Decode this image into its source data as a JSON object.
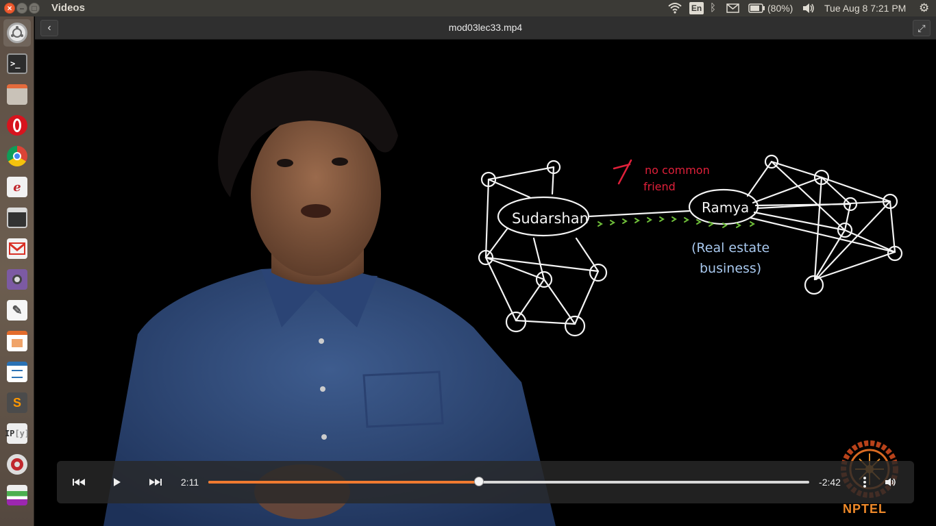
{
  "topbar": {
    "app_title": "Videos",
    "keyboard_layout": "En",
    "battery_percent": "(80%)",
    "datetime": "Tue Aug  8  7:21 PM"
  },
  "launcher": {
    "items": [
      "ubuntu-dash",
      "terminal",
      "files",
      "opera",
      "chrome",
      "evince",
      "videos",
      "gmail",
      "webcam",
      "text-editor",
      "impress",
      "writer",
      "sublime",
      "ipython",
      "settings",
      "misc"
    ]
  },
  "header": {
    "file_title": "mod03lec33.mp4",
    "back_icon": "‹",
    "fullscreen_icon": "⤢"
  },
  "whiteboard": {
    "node_left": "Sudarshan",
    "node_right": "Ramya",
    "annotation_red_line1": "no common",
    "annotation_red_line2": "friend",
    "annotation_blue_line1": "(Real estate",
    "annotation_blue_line2": "business)"
  },
  "controls": {
    "elapsed": "2:11",
    "remaining": "-2:42",
    "progress": 0.45
  },
  "branding": {
    "logo_text": "NPTEL"
  },
  "colors": {
    "accent": "#f07a30",
    "red_ink": "#e0203a",
    "blue_ink": "#a8c8ee",
    "green_ink": "#6fbf3a"
  }
}
